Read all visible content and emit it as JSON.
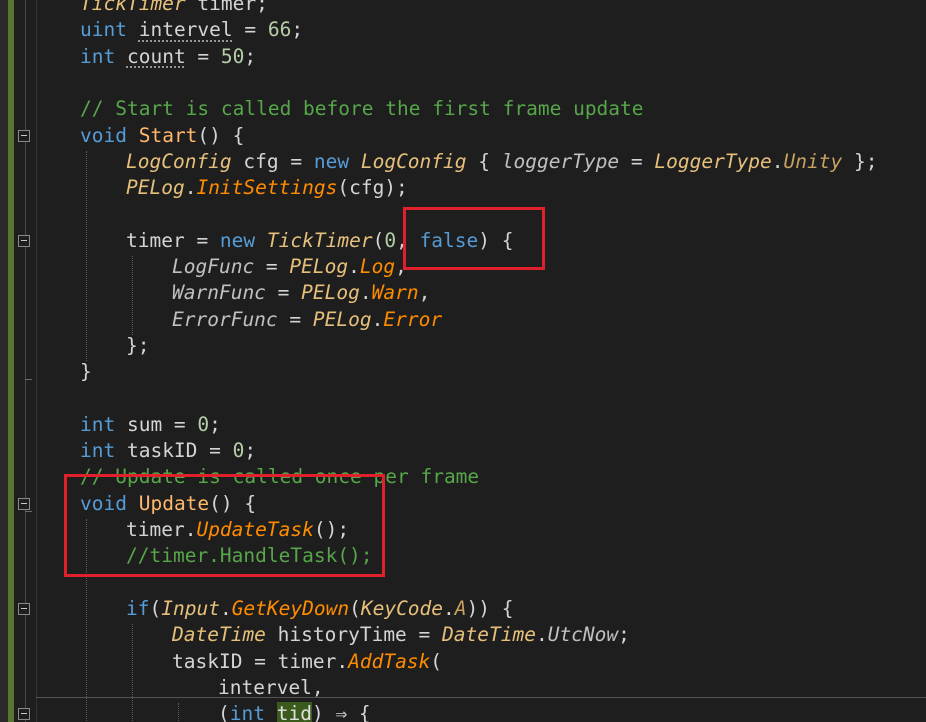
{
  "editor": {
    "lines": [
      {
        "indent": 0,
        "tokens": [
          {
            "t": "TickTimer",
            "c": "ty"
          },
          {
            "t": " timer;",
            "c": ""
          }
        ]
      },
      {
        "indent": 0,
        "tokens": [
          {
            "t": "uint",
            "c": "kw"
          },
          {
            "t": " ",
            "c": ""
          },
          {
            "t": "intervel",
            "c": "dots"
          },
          {
            "t": " = ",
            "c": ""
          },
          {
            "t": "66",
            "c": "num"
          },
          {
            "t": ";",
            "c": ""
          }
        ]
      },
      {
        "indent": 0,
        "tokens": [
          {
            "t": "int",
            "c": "kw"
          },
          {
            "t": " ",
            "c": ""
          },
          {
            "t": "count",
            "c": "dots"
          },
          {
            "t": " = ",
            "c": ""
          },
          {
            "t": "50",
            "c": "num"
          },
          {
            "t": ";",
            "c": ""
          }
        ]
      },
      {
        "indent": 0,
        "tokens": []
      },
      {
        "indent": 0,
        "tokens": [
          {
            "t": "// Start is called before the first frame update",
            "c": "cm"
          }
        ]
      },
      {
        "indent": 0,
        "fold": true,
        "tokens": [
          {
            "t": "void",
            "c": "kw"
          },
          {
            "t": " ",
            "c": ""
          },
          {
            "t": "Start",
            "c": "mf"
          },
          {
            "t": "() {",
            "c": ""
          }
        ]
      },
      {
        "indent": 1,
        "tokens": [
          {
            "t": "LogConfig",
            "c": "ty"
          },
          {
            "t": " cfg = ",
            "c": ""
          },
          {
            "t": "new",
            "c": "kw"
          },
          {
            "t": " ",
            "c": ""
          },
          {
            "t": "LogConfig",
            "c": "ty"
          },
          {
            "t": " { ",
            "c": ""
          },
          {
            "t": "loggerType",
            "c": "pr"
          },
          {
            "t": " = ",
            "c": ""
          },
          {
            "t": "LoggerType",
            "c": "ty"
          },
          {
            "t": ".",
            "c": ""
          },
          {
            "t": "Unity",
            "c": "en"
          },
          {
            "t": " };",
            "c": ""
          }
        ]
      },
      {
        "indent": 1,
        "tokens": [
          {
            "t": "PELog",
            "c": "ty"
          },
          {
            "t": ".",
            "c": ""
          },
          {
            "t": "InitSettings",
            "c": "fn"
          },
          {
            "t": "(cfg);",
            "c": ""
          }
        ]
      },
      {
        "indent": 0,
        "tokens": []
      },
      {
        "indent": 1,
        "fold": true,
        "tokens": [
          {
            "t": "timer = ",
            "c": ""
          },
          {
            "t": "new",
            "c": "kw"
          },
          {
            "t": " ",
            "c": ""
          },
          {
            "t": "TickTimer",
            "c": "ty"
          },
          {
            "t": "(",
            "c": ""
          },
          {
            "t": "0",
            "c": "num"
          },
          {
            "t": ", ",
            "c": ""
          },
          {
            "t": "false",
            "c": "kw"
          },
          {
            "t": ") {",
            "c": ""
          }
        ]
      },
      {
        "indent": 2,
        "tokens": [
          {
            "t": "LogFunc",
            "c": "pr"
          },
          {
            "t": " = ",
            "c": ""
          },
          {
            "t": "PELog",
            "c": "ty"
          },
          {
            "t": ".",
            "c": ""
          },
          {
            "t": "Log",
            "c": "fn"
          },
          {
            "t": ",",
            "c": ""
          }
        ]
      },
      {
        "indent": 2,
        "tokens": [
          {
            "t": "WarnFunc",
            "c": "pr"
          },
          {
            "t": " = ",
            "c": ""
          },
          {
            "t": "PELog",
            "c": "ty"
          },
          {
            "t": ".",
            "c": ""
          },
          {
            "t": "Warn",
            "c": "fn"
          },
          {
            "t": ",",
            "c": ""
          }
        ]
      },
      {
        "indent": 2,
        "tokens": [
          {
            "t": "ErrorFunc",
            "c": "pr"
          },
          {
            "t": " = ",
            "c": ""
          },
          {
            "t": "PELog",
            "c": "ty"
          },
          {
            "t": ".",
            "c": ""
          },
          {
            "t": "Error",
            "c": "fn"
          }
        ]
      },
      {
        "indent": 1,
        "tokens": [
          {
            "t": "};",
            "c": ""
          }
        ]
      },
      {
        "indent": 0,
        "tokens": [
          {
            "t": "}",
            "c": ""
          }
        ]
      },
      {
        "indent": 0,
        "tokens": []
      },
      {
        "indent": 0,
        "tokens": [
          {
            "t": "int",
            "c": "kw"
          },
          {
            "t": " sum = ",
            "c": ""
          },
          {
            "t": "0",
            "c": "num"
          },
          {
            "t": ";",
            "c": ""
          }
        ]
      },
      {
        "indent": 0,
        "tokens": [
          {
            "t": "int",
            "c": "kw"
          },
          {
            "t": " taskID = ",
            "c": ""
          },
          {
            "t": "0",
            "c": "num"
          },
          {
            "t": ";",
            "c": ""
          }
        ]
      },
      {
        "indent": 0,
        "tokens": [
          {
            "t": "// Update is called once per frame",
            "c": "cm"
          }
        ]
      },
      {
        "indent": 0,
        "fold": true,
        "tokens": [
          {
            "t": "void",
            "c": "kw"
          },
          {
            "t": " ",
            "c": ""
          },
          {
            "t": "Update",
            "c": "mf"
          },
          {
            "t": "() {",
            "c": ""
          }
        ]
      },
      {
        "indent": 1,
        "tokens": [
          {
            "t": "timer.",
            "c": ""
          },
          {
            "t": "UpdateTask",
            "c": "fn"
          },
          {
            "t": "();",
            "c": ""
          }
        ]
      },
      {
        "indent": 1,
        "tokens": [
          {
            "t": "//timer.HandleTask();",
            "c": "cm"
          }
        ]
      },
      {
        "indent": 0,
        "tokens": []
      },
      {
        "indent": 1,
        "fold": true,
        "tokens": [
          {
            "t": "if",
            "c": "kw"
          },
          {
            "t": "(",
            "c": ""
          },
          {
            "t": "Input",
            "c": "ty"
          },
          {
            "t": ".",
            "c": ""
          },
          {
            "t": "GetKeyDown",
            "c": "fn"
          },
          {
            "t": "(",
            "c": ""
          },
          {
            "t": "KeyCode",
            "c": "ty"
          },
          {
            "t": ".",
            "c": ""
          },
          {
            "t": "A",
            "c": "en"
          },
          {
            "t": ")) {",
            "c": ""
          }
        ]
      },
      {
        "indent": 2,
        "tokens": [
          {
            "t": "DateTime",
            "c": "ty"
          },
          {
            "t": " historyTime = ",
            "c": ""
          },
          {
            "t": "DateTime",
            "c": "ty"
          },
          {
            "t": ".",
            "c": ""
          },
          {
            "t": "UtcNow",
            "c": "pr"
          },
          {
            "t": ";",
            "c": ""
          }
        ]
      },
      {
        "indent": 2,
        "tokens": [
          {
            "t": "taskID = timer.",
            "c": ""
          },
          {
            "t": "AddTask",
            "c": "fn"
          },
          {
            "t": "(",
            "c": ""
          }
        ]
      },
      {
        "indent": 3,
        "tokens": [
          {
            "t": "intervel,",
            "c": ""
          }
        ]
      },
      {
        "indent": 3,
        "fold": true,
        "tokens": [
          {
            "t": "(",
            "c": ""
          },
          {
            "t": "int",
            "c": "kw"
          },
          {
            "t": " ",
            "c": ""
          },
          {
            "t": "tid",
            "c": "hl"
          },
          {
            "t": ") ⇒ {",
            "c": ""
          }
        ]
      }
    ]
  }
}
